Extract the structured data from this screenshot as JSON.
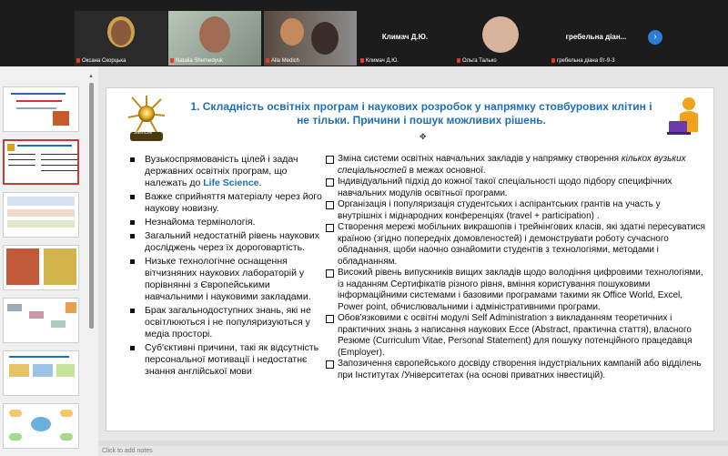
{
  "participants": [
    {
      "name": "Оксана Скорцька",
      "muted": true
    },
    {
      "name": "Natalia Shemedyuk",
      "muted": true
    },
    {
      "name": "Alla Medich",
      "muted": true
    },
    {
      "name": "Климач Д.Ю.",
      "label": "Климач Д.Ю.",
      "muted": true
    },
    {
      "name": "Ольга Талько",
      "muted": true
    },
    {
      "name": "гребельна діана бт-9-3",
      "label": "гребельна діан...",
      "muted": true
    }
  ],
  "slide_panel": {
    "thumbnail_count": 7,
    "selected_index": 1
  },
  "slide": {
    "logo_text": "StemCell",
    "title": "1. Складність освітніх програм і наукових розробок у напрямку стовбурових клітин і не тільки. Причини і пошук можливих рішень.",
    "left_items": [
      {
        "pre": "Вузькоспрямованість цілей і задач державних освітніх програм, що належать до ",
        "highlight": "Life Science",
        "post": "."
      },
      {
        "pre": "Важке сприйняття матеріалу через його наукову новизну.",
        "highlight": "",
        "post": ""
      },
      {
        "pre": "Незнайома термінологія.",
        "highlight": "",
        "post": ""
      },
      {
        "pre": "Загальний недостатній рівень наукових досліджень через їх дороговартість.",
        "highlight": "",
        "post": ""
      },
      {
        "pre": "Низьке технологічне оснащення вітчизняних наукових лабораторій у порівнянні з Європейськими навчальними і науковими закладами.",
        "highlight": "",
        "post": ""
      },
      {
        "pre": "Брак загальнодоступних знань, які не освітлюються і не популяризуються у медіа просторі.",
        "highlight": "",
        "post": ""
      },
      {
        "pre": "Суб'єктивні причини, такі як відсутність персональної мотивації  і недостатнє знання англійської мови",
        "highlight": "",
        "post": ""
      }
    ],
    "right_items": [
      {
        "pre": "Зміна системи освітніх навчальних закладів у напрямку створення ",
        "italic": "кількох вузьких спеціальностей",
        "post": " в межах основної."
      },
      {
        "pre": "Індивідуальний підхід до кожної такої спеціальності щодо підбору специфічних навчальних  модулів  освітньої програми.",
        "italic": "",
        "post": ""
      },
      {
        "pre": "Організація і популяризація студентських і аспірантських грантів на участь у внутрішніх і міднародних конференціях (travel + participation) .",
        "italic": "",
        "post": ""
      },
      {
        "pre": "Створення мережі мобільних викрашопів і трейнінгових класів, які здатні пересуватися країною (згідно попередніх домовленостей) і демонструвати роботу сучасного обладнання, щоби наочно ознайомити студентів з технологіями, методами і обладнанням.",
        "italic": "",
        "post": ""
      },
      {
        "pre": "Високий рівень випускників вищих закладів щодо володіння  цифровими технологіями, із наданням Сертифікатів різного рівня, вміння користування пошуковими інформаційними системами і базовими програмами такими як Office World, Excel, Power point, обчислювальними і адміністративними програми.",
        "italic": "",
        "post": ""
      },
      {
        "pre": "Обов'язковими є освітні модулі Self Administration з викладанням теоретичних і практичних знань з написання наукових Ессе (Abstract, практична стаття), власного Резюме (Curriculum Vitae, Personal Statement) для пошуку потенційного працедавця (Employer).",
        "italic": "",
        "post": ""
      },
      {
        "pre": "Запозичення європейського досвіду створення індустріальних кампаній або відділень при Інститутах /Університетах (на основі приватних інвестицій).",
        "italic": "",
        "post": ""
      }
    ]
  },
  "notes_placeholder": "Click to add notes",
  "colors": {
    "title": "#1e6fb8",
    "highlight": "#1e6fb8",
    "selected_border": "#c43b3b",
    "strip_bg": "#1c1c1c"
  }
}
